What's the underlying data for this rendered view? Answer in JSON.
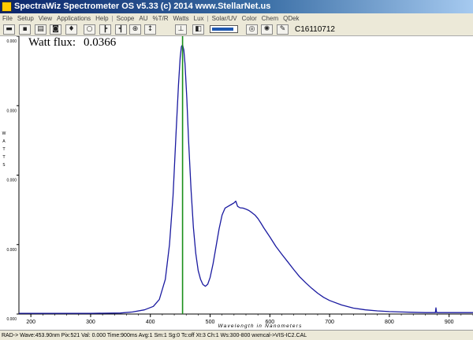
{
  "window": {
    "title": "SpectraWiz  Spectrometer OS v5.33 (c) 2014    www.StellarNet.us"
  },
  "menu": [
    "File",
    "Setup",
    "View",
    "Applications",
    "Help",
    "|",
    "Scope",
    "AU",
    "%T/R",
    "Watts",
    "Lux",
    "|",
    "Solar/UV",
    "Color",
    "Chem",
    "QDek"
  ],
  "toolbar": {
    "buttons": [
      "open-icon",
      "save-icon",
      "print-icon",
      "camera-icon",
      "pin-icon",
      "bulb-icon",
      "marker-left-icon",
      "marker-right-icon",
      "zoom-icon",
      "scale-icon",
      "peak-icon",
      "dark-icon"
    ],
    "integration_fill": 0.85,
    "detector_id": "C16110712",
    "extra_buttons": [
      "light-ring-icon",
      "color-wheel-icon",
      "palette-icon"
    ]
  },
  "readout": {
    "label": "Watt flux:",
    "value": "0.0366"
  },
  "status": {
    "text": "RAD->  Wave:453.90nm  Pix:521  Val:  0.000  Time:900ms  Avg:1  Sm:1  Sg:0  Tc:off  Xt:3  Ch:1  Ws:300-800 wxmcal->VIS-IC2.CAL"
  },
  "chart_data": {
    "type": "line",
    "x_ticks": [
      "200",
      "300",
      "400",
      "500",
      "600",
      "700",
      "800",
      "900"
    ],
    "xlim": [
      180,
      940
    ],
    "ylim": [
      0,
      0.0008
    ],
    "y_ticks": [
      "0.000",
      "0.000",
      "0.000",
      "0.000",
      "0.000"
    ],
    "y_tick_values": [
      0,
      0.0002,
      0.0004,
      0.0006,
      0.0008
    ],
    "xlabel": "Wavelength in Nanometers",
    "ylabel": "WATTS",
    "cursor_x": 453.9,
    "colors": {
      "line": "#1a1aa0",
      "cursor": "#1a8f1a",
      "axis": "#000000"
    },
    "series": [
      {
        "x": [
          180,
          300,
          350,
          370,
          390,
          405,
          415,
          425,
          432,
          438,
          443,
          447,
          450,
          452,
          453.9,
          456,
          458,
          461,
          464,
          468,
          472,
          476,
          480,
          484,
          488,
          492,
          496,
          500,
          505,
          510,
          515,
          520,
          525,
          530,
          535,
          540,
          543,
          546,
          550,
          555,
          560,
          565,
          570,
          575,
          580,
          585,
          590,
          600,
          610,
          620,
          630,
          640,
          650,
          660,
          670,
          680,
          690,
          700,
          720,
          740,
          760,
          780,
          800,
          820,
          840,
          860,
          877,
          878,
          879,
          890,
          910,
          940
        ],
        "y": [
          2e-06,
          2e-06,
          3e-06,
          6e-06,
          1.2e-05,
          2.2e-05,
          4.2e-05,
          0.0001,
          0.0002,
          0.00034,
          0.00052,
          0.00066,
          0.00074,
          0.00077,
          0.000775,
          0.00076,
          0.00072,
          0.00062,
          0.0005,
          0.00036,
          0.00025,
          0.000175,
          0.000125,
          0.0001,
          8.5e-05,
          8e-05,
          8.6e-05,
          0.000105,
          0.000145,
          0.000195,
          0.000245,
          0.000285,
          0.000305,
          0.00031,
          0.000315,
          0.00032,
          0.000325,
          0.00031,
          0.000306,
          0.000305,
          0.000302,
          0.000298,
          0.000292,
          0.000285,
          0.000275,
          0.000262,
          0.000248,
          0.000222,
          0.000195,
          0.000172,
          0.00015,
          0.000128,
          0.000107,
          9e-05,
          7.4e-05,
          6e-05,
          4.8e-05,
          3.9e-05,
          2.6e-05,
          1.7e-05,
          1.2e-05,
          9e-06,
          7e-06,
          6e-06,
          5e-06,
          4e-06,
          4e-06,
          1.8e-05,
          4e-06,
          4e-06,
          4e-06,
          4e-06
        ]
      }
    ]
  }
}
